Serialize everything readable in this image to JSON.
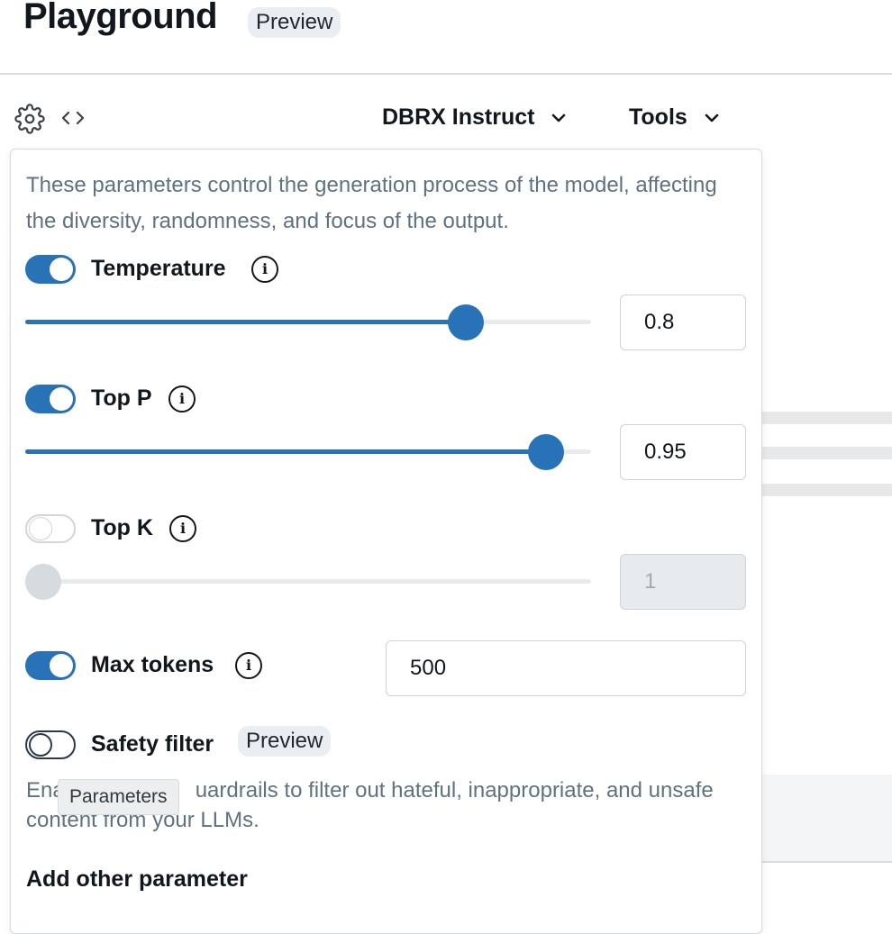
{
  "header": {
    "title": "Playground",
    "badge": "Preview"
  },
  "toolbar": {
    "model": "DBRX Instruct",
    "tools": "Tools"
  },
  "icons": {
    "settings": "gear-icon",
    "code": "code-icon",
    "chevron": "chevron-down-icon",
    "info": "info-icon"
  },
  "colors": {
    "accent": "#2872b7",
    "muted_text": "#5f7281",
    "border": "#cdd3d8"
  },
  "panel": {
    "description": "These parameters control the generation process of the model, affecting the diversity, randomness, and focus of the output.",
    "params": {
      "temperature": {
        "label": "Temperature",
        "enabled": true,
        "value": "0.8",
        "slider_fraction": 0.78
      },
      "top_p": {
        "label": "Top P",
        "enabled": true,
        "value": "0.95",
        "slider_fraction": 0.92
      },
      "top_k": {
        "label": "Top K",
        "enabled": false,
        "value": "1",
        "slider_fraction": 0.0
      },
      "max_tokens": {
        "label": "Max tokens",
        "enabled": true,
        "value": "500"
      }
    },
    "safety": {
      "label": "Safety filter",
      "enabled": false,
      "badge": "Preview",
      "description_start": "Ena",
      "description_rest": "uardrails to filter out hateful, inappropriate, and unsafe content from your LLMs."
    },
    "tooltip": "Parameters",
    "add_other": "Add other parameter"
  }
}
